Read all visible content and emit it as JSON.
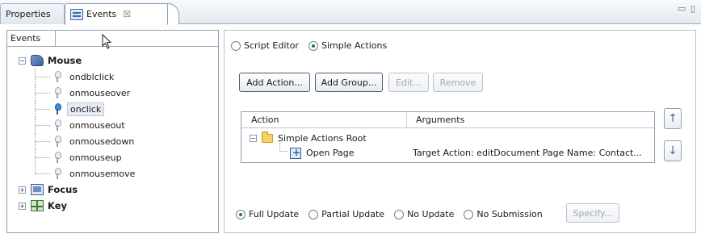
{
  "tabs": {
    "properties_label": "Properties",
    "events_label": "Events",
    "close_glyph": "☒",
    "window_controls": "▭ ▯"
  },
  "left_panel": {
    "header": "Events",
    "tree": {
      "mouse": {
        "label": "Mouse",
        "expander": "−",
        "children": [
          "ondblclick",
          "onmouseover",
          "onclick",
          "onmouseout",
          "onmousedown",
          "onmouseup",
          "onmousemove"
        ],
        "selected": "onclick"
      },
      "focus": {
        "label": "Focus",
        "expander": "+"
      },
      "key": {
        "label": "Key",
        "expander": "+"
      }
    }
  },
  "right_panel": {
    "mode": {
      "options": [
        "Script Editor",
        "Simple Actions"
      ],
      "selected": "Simple Actions"
    },
    "buttons": {
      "add_action": "Add Action...",
      "add_group": "Add Group...",
      "edit": "Edit...",
      "remove": "Remove"
    },
    "table": {
      "columns": [
        "Action",
        "Arguments"
      ],
      "rows": [
        {
          "label": "Simple Actions Root",
          "arguments": "",
          "expander": "−"
        },
        {
          "label": "Open Page",
          "arguments": "Target Action: editDocument Page Name: Contact..."
        }
      ]
    },
    "move_up_glyph": "↑",
    "move_down_glyph": "↓",
    "update": {
      "options": [
        "Full Update",
        "Partial Update",
        "No Update",
        "No Submission"
      ],
      "selected": "Full Update"
    },
    "specify_label": "Specify..."
  },
  "colors": {
    "accent_green": "#1e7b2c",
    "border_blue": "#8f9fb5",
    "tab_bg": "#e4eaf2"
  }
}
